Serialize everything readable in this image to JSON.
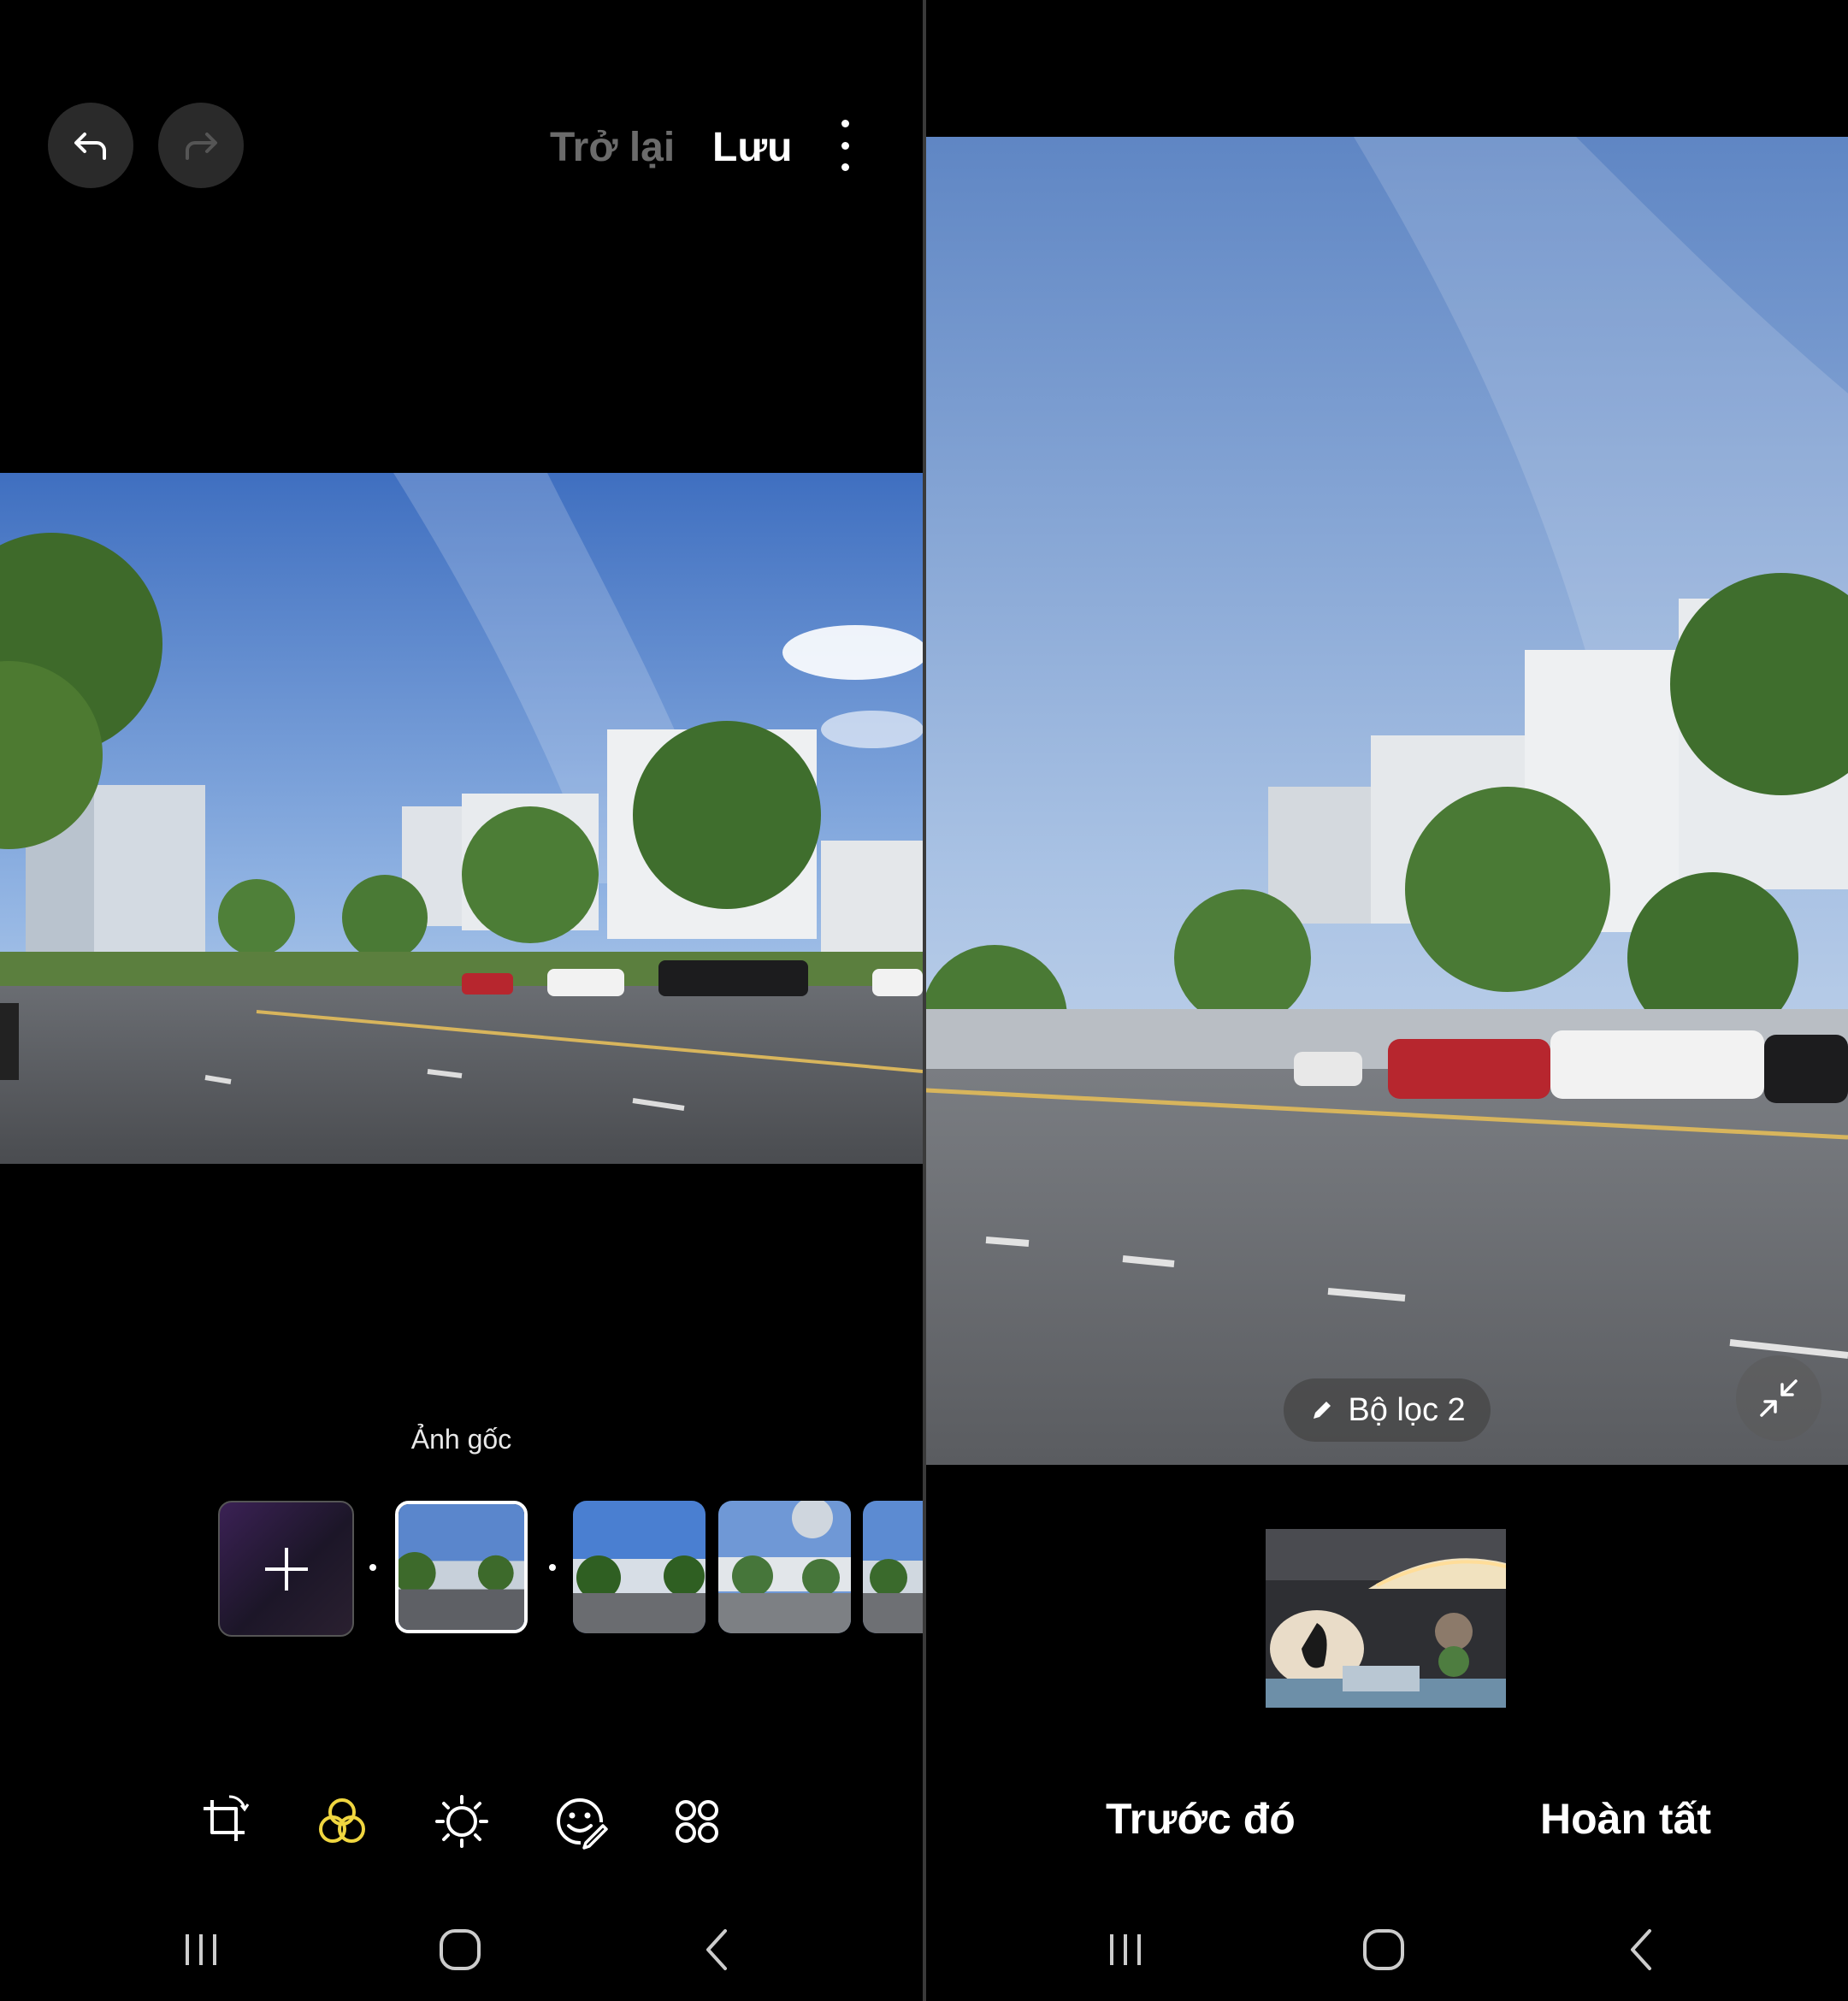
{
  "left": {
    "header": {
      "back_label": "Trở lại",
      "save_label": "Lưu"
    },
    "filter": {
      "current_filter_name": "Ảnh gốc",
      "thumbnails": [
        "add-filter",
        "original",
        "filter-1",
        "filter-2",
        "filter-3"
      ]
    },
    "toolbar": {
      "items": [
        "crop-rotate-icon",
        "filter-icon",
        "brightness-icon",
        "sticker-icon",
        "more-tools-icon"
      ],
      "active_color": "#f0d640"
    }
  },
  "right": {
    "filter_pill_label": "Bộ lọc 2",
    "previous_label": "Trước đó",
    "done_label": "Hoàn tất"
  },
  "nav": {
    "items": [
      "recent-apps-icon",
      "home-icon",
      "back-icon"
    ]
  }
}
